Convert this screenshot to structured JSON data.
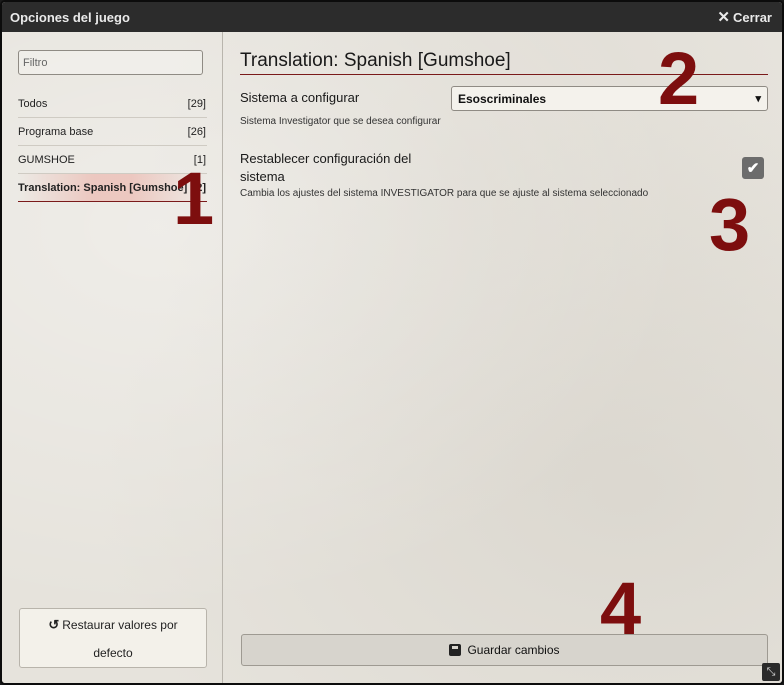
{
  "window": {
    "title": "Opciones del juego",
    "close_label": "Cerrar",
    "close_icon": "close-icon"
  },
  "sidebar": {
    "filter_placeholder": "Filtro",
    "categories": [
      {
        "label": "Todos",
        "count": "[29]"
      },
      {
        "label": "Programa base",
        "count": "[26]"
      },
      {
        "label": "GUMSHOE",
        "count": "[1]"
      },
      {
        "label": "Translation: Spanish [Gumshoe]",
        "count": "[2]",
        "active": true
      }
    ],
    "reset_label": "Restaurar valores por defecto",
    "reset_icon": "undo-icon"
  },
  "main": {
    "heading": "Translation: Spanish [Gumshoe]",
    "system_label": "Sistema a configurar",
    "system_value": "Esoscriminales",
    "system_hint": "Sistema Investigator que se desea configurar",
    "reset_system_label": "Restablecer configuración del sistema",
    "reset_system_checked": true,
    "reset_system_hint": "Cambia los ajustes del sistema INVESTIGATOR para que se ajuste al sistema seleccionado",
    "save_label": "Guardar cambios",
    "save_icon": "save-icon"
  },
  "annotations": [
    "1",
    "2",
    "3",
    "4"
  ],
  "colors": {
    "titlebar": "#2c2c2c",
    "accent": "#7a1a1a",
    "annotation": "#7d0e0e",
    "active_highlight": "#ebaaa0"
  }
}
